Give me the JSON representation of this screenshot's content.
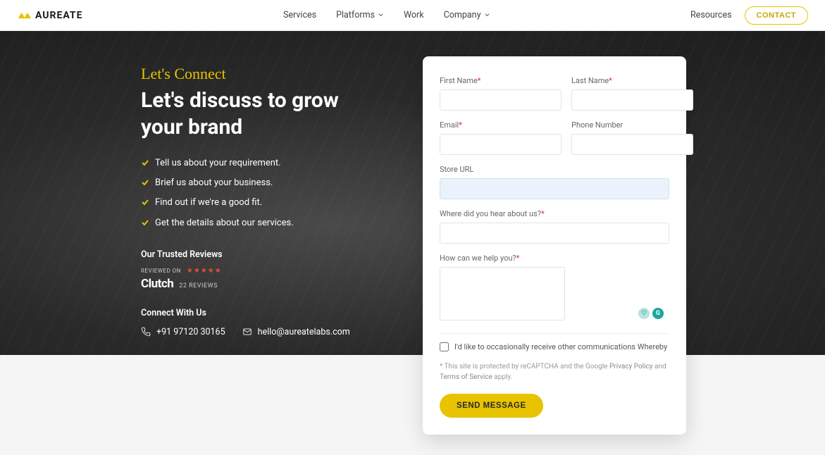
{
  "header": {
    "brand": "AUREATE",
    "nav": {
      "services": "Services",
      "platforms": "Platforms",
      "work": "Work",
      "company": "Company"
    },
    "resources": "Resources",
    "contact_button": "CONTACT"
  },
  "hero": {
    "kicker": "Let's Connect",
    "headline": "Let's discuss to grow your brand",
    "checklist": [
      "Tell us about your requirement.",
      "Brief us about your business.",
      "Find out if we're a good fit.",
      "Get the details about our services."
    ],
    "reviews_label": "Our Trusted Reviews",
    "clutch": {
      "reviewed_on": "REVIEWED ON",
      "brand": "Clutch",
      "count": "22 REVIEWS"
    },
    "connect_label": "Connect With Us",
    "phone": "+91 97120 30165",
    "email": "hello@aureatelabs.com"
  },
  "form": {
    "first_name_label": "First Name",
    "last_name_label": "Last Name",
    "email_label": "Email",
    "phone_label": "Phone Number",
    "store_url_label": "Store URL",
    "hear_label": "Where did you hear about us?",
    "help_label": "How can we help you?",
    "checkbox_label": "I'd like to occasionally receive other communications Whereby",
    "legal_prefix": "* This site is protected by reCAPTCHA and the Google ",
    "legal_privacy": "Privacy Policy",
    "legal_and": " and ",
    "legal_terms": "Terms of Service",
    "legal_suffix": " apply.",
    "send_button": "SEND MESSAGE"
  }
}
